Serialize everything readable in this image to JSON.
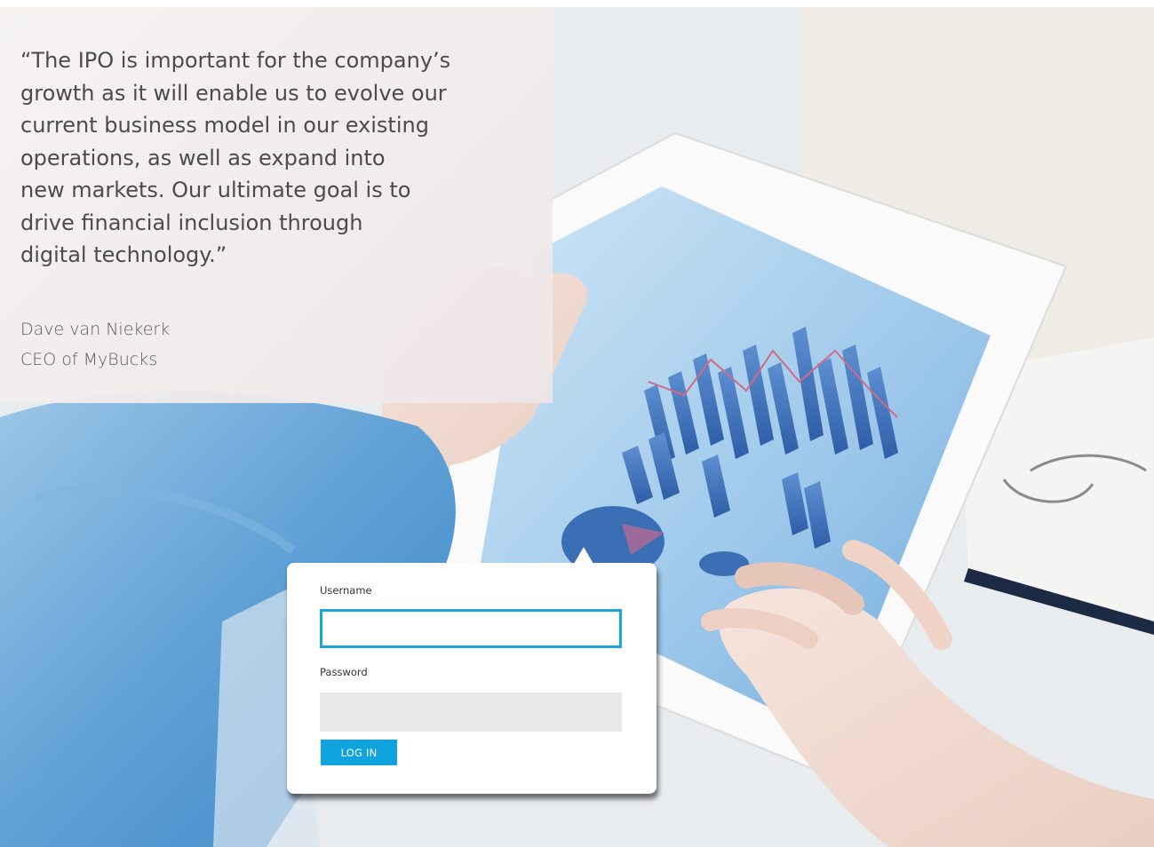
{
  "quote": {
    "text": "“The IPO is important for the company’s\ngrowth as it will enable us to evolve our\ncurrent business model in our existing\noperations, as well as expand into\nnew markets. Our ultimate goal is to\ndrive financial inclusion through\ndigital technology.”",
    "author_name": "Dave van Niekerk",
    "author_title": "CEO of MyBucks"
  },
  "login": {
    "username_label": "Username",
    "username_value": "",
    "password_label": "Password",
    "password_value": "",
    "submit_label": "LOG IN"
  },
  "colors": {
    "accent": "#0fa4e0",
    "focus_border": "#1aa6dc",
    "password_bg": "#e8e8e8",
    "quote_text": "#4b4b4b"
  }
}
